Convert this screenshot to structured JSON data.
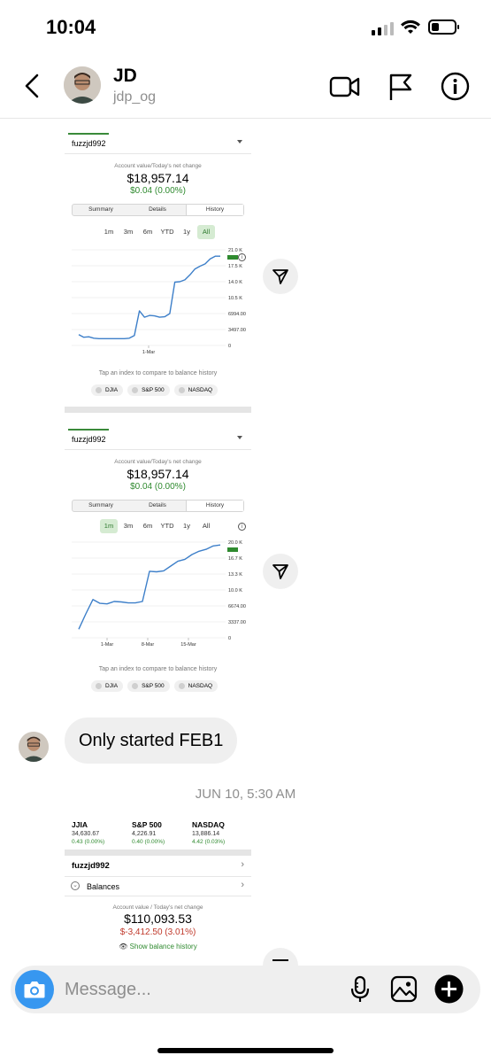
{
  "status_bar": {
    "time": "10:04"
  },
  "header": {
    "name": "JD",
    "username": "jdp_og"
  },
  "cards": [
    {
      "account": "fuzzjd992",
      "label": "Account value/Today's net change",
      "value": "$18,957.14",
      "change": "$0.04 (0.00%)",
      "segments": [
        "Summary",
        "Details",
        "History"
      ],
      "ranges": [
        "1m",
        "3m",
        "6m",
        "YTD",
        "1y",
        "All"
      ],
      "selected_range": "All",
      "y_ticks": [
        "21.0 K",
        "17.5 K",
        "14.0 K",
        "10.5 K",
        "6994.00",
        "3497.00",
        "0"
      ],
      "x_ticks": [
        "1-Mar"
      ],
      "compare_text": "Tap an index to compare to balance history",
      "indexes": [
        "DJIA",
        "S&P 500",
        "NASDAQ"
      ]
    },
    {
      "account": "fuzzjd992",
      "label": "Account value/Today's net change",
      "value": "$18,957.14",
      "change": "$0.04 (0.00%)",
      "segments": [
        "Summary",
        "Details",
        "History"
      ],
      "ranges": [
        "1m",
        "3m",
        "6m",
        "YTD",
        "1y",
        "All"
      ],
      "selected_range": "1m",
      "y_ticks": [
        "20.0 K",
        "16.7 K",
        "13.3 K",
        "10.0 K",
        "6674.00",
        "3337.00",
        "0"
      ],
      "x_ticks": [
        "1-Mar",
        "8-Mar",
        "15-Mar"
      ],
      "compare_text": "Tap an index to compare to balance history",
      "indexes": [
        "DJIA",
        "S&P 500",
        "NASDAQ"
      ]
    }
  ],
  "message": {
    "text": "Only started FEB1"
  },
  "timestamp": "JUN 10, 5:30 AM",
  "card3": {
    "indexes": [
      {
        "name": "JJIA",
        "value": "34,630.67",
        "change": "0.43 (0.00%)"
      },
      {
        "name": "S&P 500",
        "value": "4,226.91",
        "change": "0.40 (0.00%)"
      },
      {
        "name": "NASDAQ",
        "value": "13,886.14",
        "change": "4.42 (0.03%)"
      }
    ],
    "account": "fuzzjd992",
    "balances": "Balances",
    "label": "Account value / Today's net change",
    "value": "$110,093.53",
    "change": "$-3,412.50 (3.01%)",
    "show_history": "Show balance history"
  },
  "composer": {
    "placeholder": "Message..."
  },
  "colors": {
    "accent": "#3797f0",
    "positive": "#2f8a2f",
    "negative": "#c0392b",
    "line": "#3d7fc9"
  },
  "chart_data": [
    {
      "type": "line",
      "xlabel": "",
      "ylabel": "",
      "x_ticks": [
        "1-Mar"
      ],
      "ylim": [
        0,
        21000
      ],
      "series": [
        {
          "values": [
            2400,
            1800,
            1900,
            1600,
            1500,
            1500,
            1500,
            1500,
            1500,
            1500,
            1600,
            2200,
            7600,
            6200,
            6600,
            6500,
            6200,
            6300,
            7000,
            13900,
            14000,
            14400,
            15500,
            16800,
            17400,
            17900,
            19000,
            19600,
            19600
          ]
        }
      ]
    },
    {
      "type": "line",
      "xlabel": "",
      "ylabel": "",
      "x_ticks": [
        "1-Mar",
        "8-Mar",
        "15-Mar"
      ],
      "ylim": [
        0,
        20000
      ],
      "series": [
        {
          "values": [
            1800,
            5000,
            8000,
            7200,
            7100,
            7600,
            7500,
            7300,
            7300,
            7600,
            13900,
            13800,
            14000,
            15000,
            16000,
            16400,
            17400,
            18100,
            18500,
            19200,
            19400
          ]
        }
      ]
    }
  ]
}
